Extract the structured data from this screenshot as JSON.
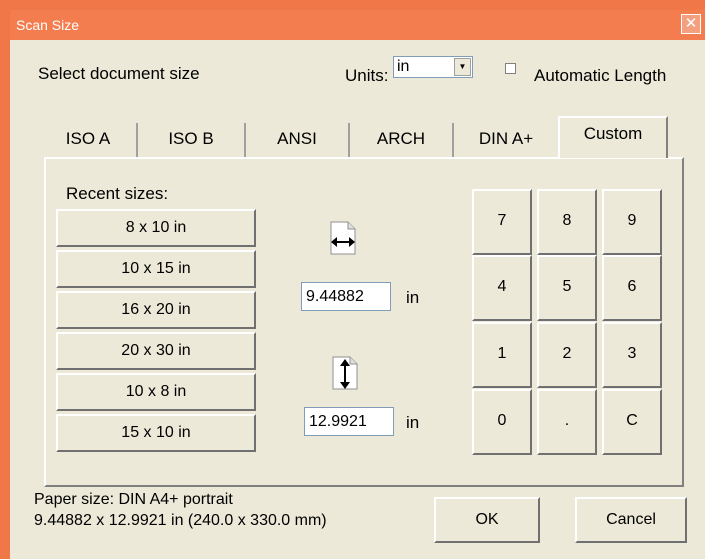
{
  "window": {
    "title": "Scan Size",
    "close_glyph": "✕"
  },
  "header": {
    "select_label": "Select document size",
    "units_label": "Units:",
    "units_value": "in",
    "auto_length_label": "Automatic Length"
  },
  "tabs": [
    {
      "label": "ISO A"
    },
    {
      "label": "ISO B"
    },
    {
      "label": "ANSI"
    },
    {
      "label": "ARCH"
    },
    {
      "label": "DIN A+"
    },
    {
      "label": "Custom"
    }
  ],
  "recent": {
    "label": "Recent sizes:",
    "sizes": [
      "8 x 10 in",
      "10 x 15 in",
      "16 x 20 in",
      "20 x 30 in",
      "10 x 8 in",
      "15 x 10 in"
    ]
  },
  "width": {
    "value": "9.44882",
    "unit": "in",
    "icon": "width-icon"
  },
  "height": {
    "value": "12.9921",
    "unit": "in",
    "icon": "height-icon"
  },
  "keypad": [
    "7",
    "8",
    "9",
    "4",
    "5",
    "6",
    "1",
    "2",
    "3",
    "0",
    ".",
    "C"
  ],
  "footer": {
    "paper_line1": "Paper size:  DIN A4+ portrait",
    "paper_line2": "9.44882 x 12.9921 in  (240.0 x 330.0 mm)",
    "ok_label": "OK",
    "cancel_label": "Cancel"
  }
}
